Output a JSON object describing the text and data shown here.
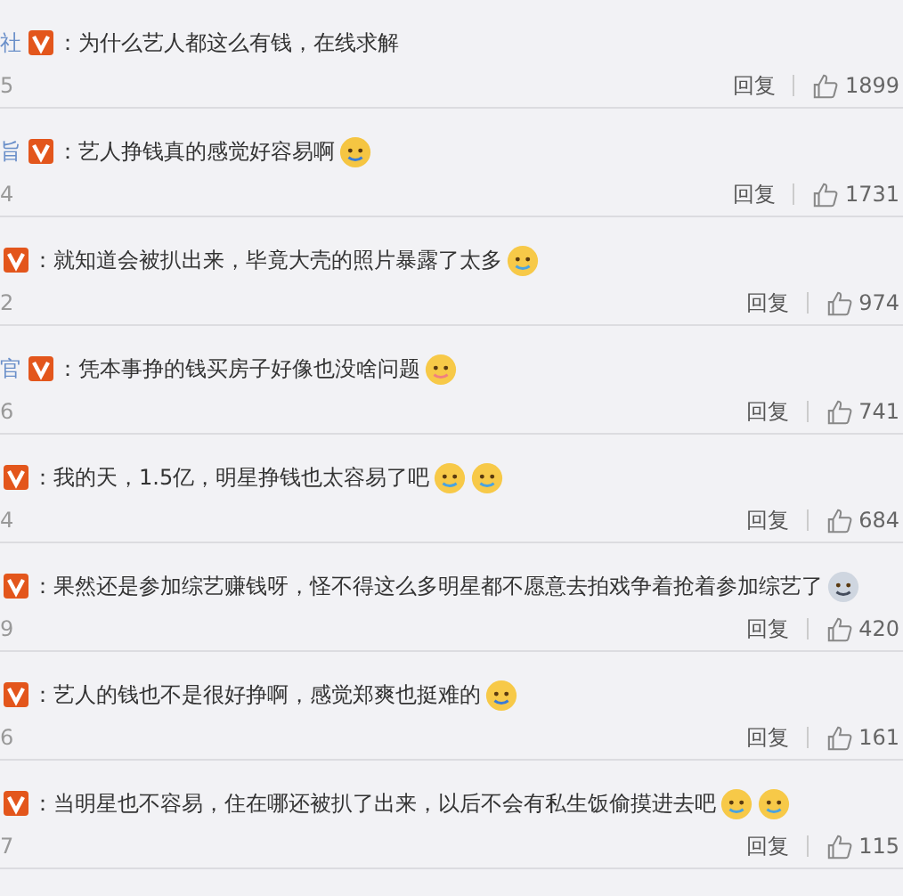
{
  "comments": [
    {
      "user": "社",
      "colon": "：",
      "text": "为什么艺人都这么有钱，在线求解",
      "time": "5",
      "reply": "回复",
      "likes": "1899"
    },
    {
      "user": "旨",
      "colon": "：",
      "text": "艺人挣钱真的感觉好容易啊",
      "emojis": [
        {
          "kind": "figure"
        }
      ],
      "time": "4",
      "reply": "回复",
      "likes": "1731"
    },
    {
      "colon": "：",
      "text": "就知道会被扒出来，毕竟大壳的照片暴露了太多",
      "emojis": [
        {
          "kind": "laugh-cry"
        }
      ],
      "time": "2",
      "reply": "回复",
      "likes": "974"
    },
    {
      "user": "官",
      "colon": "：",
      "text": "凭本事挣的钱买房子好像也没啥问题",
      "emojis": [
        {
          "kind": "blush"
        }
      ],
      "time": "6",
      "reply": "回复",
      "likes": "741"
    },
    {
      "colon": "：",
      "text": "我的天，1.5亿，明星挣钱也太容易了吧",
      "emojis": [
        {
          "kind": "cry"
        },
        {
          "kind": "cry"
        }
      ],
      "time": "4",
      "reply": "回复",
      "likes": "684"
    },
    {
      "colon": "：",
      "text": "果然还是参加综艺赚钱呀，怪不得这么多明星都不愿意去拍戏争着抢着参加综艺了",
      "emojis": [
        {
          "kind": "husky"
        }
      ],
      "time": "9",
      "reply": "回复",
      "likes": "420"
    },
    {
      "colon": "：",
      "text": "艺人的钱也不是很好挣啊，感觉郑爽也挺难的",
      "emojis": [
        {
          "kind": "shrug"
        }
      ],
      "time": "6",
      "reply": "回复",
      "likes": "161"
    },
    {
      "colon": "：",
      "text": "当明星也不容易，住在哪还被扒了出来，以后不会有私生饭偷摸进去吧",
      "emojis": [
        {
          "kind": "laugh-cry"
        },
        {
          "kind": "laugh-cry"
        }
      ],
      "time": "7",
      "reply": "回复",
      "likes": "115"
    }
  ]
}
